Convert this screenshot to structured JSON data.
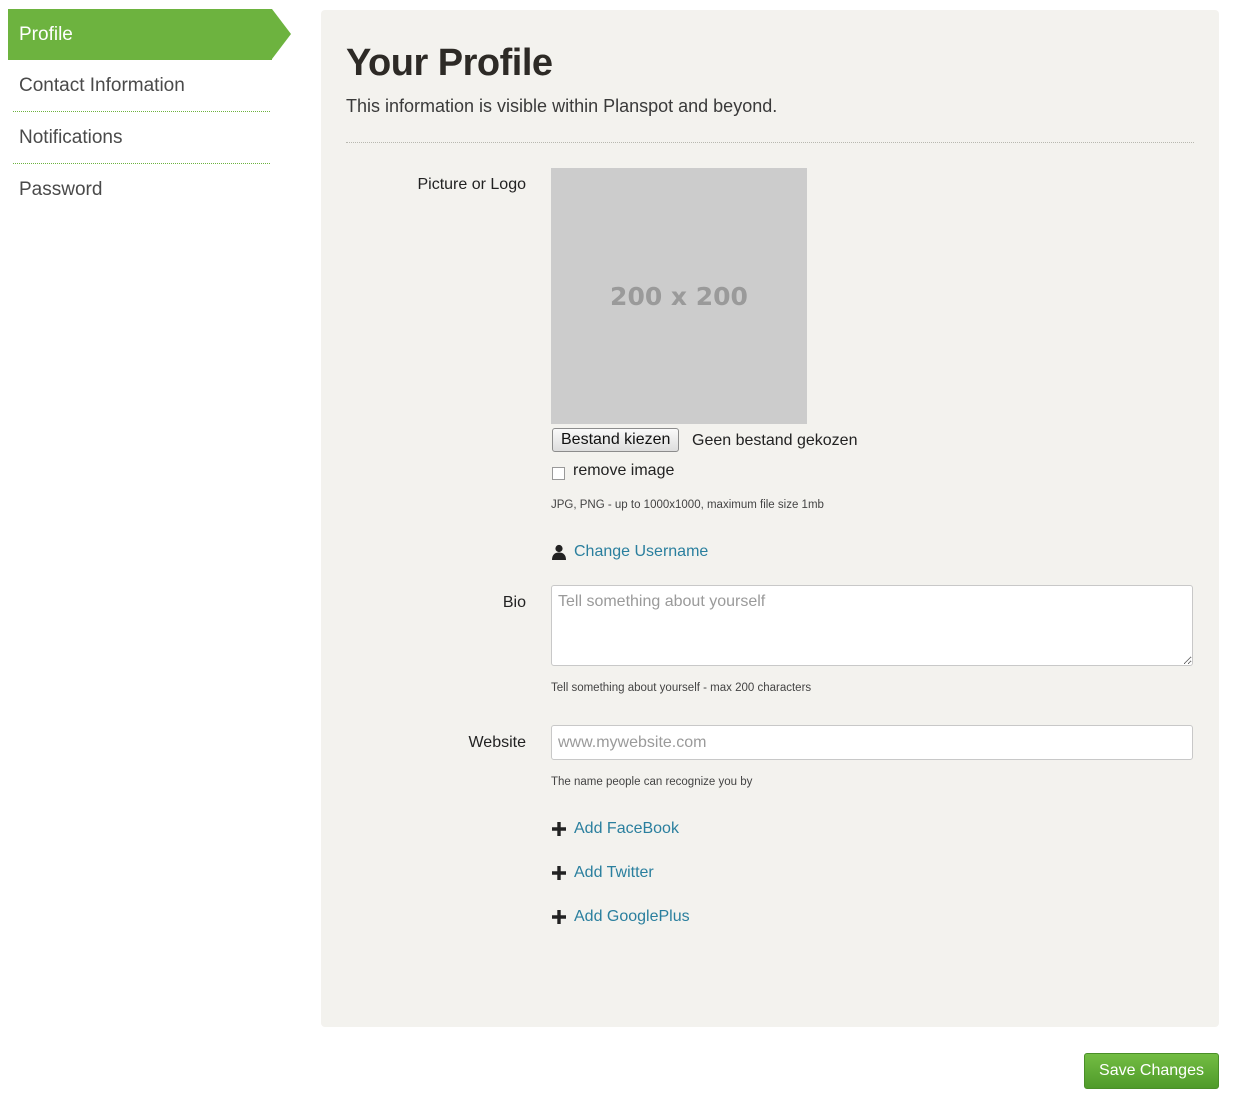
{
  "sidebar": {
    "items": [
      {
        "label": "Profile"
      },
      {
        "label": "Contact Information"
      },
      {
        "label": "Notifications"
      },
      {
        "label": "Password"
      }
    ]
  },
  "main": {
    "title": "Your Profile",
    "subtitle": "This information is visible within Planspot and beyond.",
    "picture": {
      "label": "Picture or Logo",
      "placeholder_text": "200 x 200",
      "file_button": "Bestand kiezen",
      "file_status": "Geen bestand gekozen",
      "remove_label": "remove image",
      "remove_checked": false,
      "hint": "JPG, PNG - up to 1000x1000, maximum file size 1mb"
    },
    "change_username": {
      "label": "Change Username",
      "icon": "user-icon"
    },
    "bio": {
      "label": "Bio",
      "value": "",
      "placeholder": "Tell something about yourself",
      "hint": "Tell something about yourself - max 200 characters"
    },
    "website": {
      "label": "Website",
      "value": "",
      "placeholder": "www.mywebsite.com",
      "hint": "The name people can recognize you by"
    },
    "social_links": [
      {
        "label": "Add FaceBook",
        "icon": "plus-icon"
      },
      {
        "label": "Add Twitter",
        "icon": "plus-icon"
      },
      {
        "label": "Add GooglePlus",
        "icon": "plus-icon"
      }
    ]
  },
  "save_button": "Save Changes",
  "colors": {
    "accent": "#6db33f",
    "link": "#2a7f9e",
    "panel_bg": "#f3f2ee",
    "placeholder_bg": "#cccccc"
  }
}
